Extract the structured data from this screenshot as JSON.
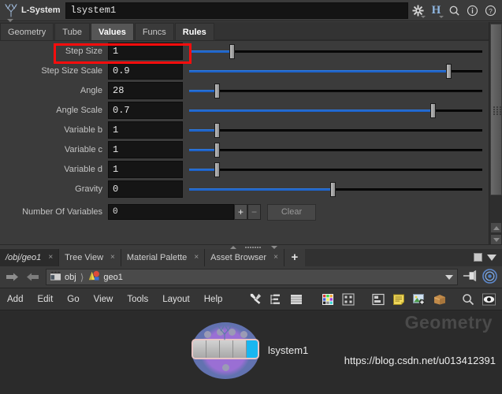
{
  "param_editor": {
    "op_type_icon": "lsystem-tree-icon",
    "op_type_label": "L-System",
    "op_name_value": "lsystem1",
    "header_icons": [
      {
        "name": "gear-icon",
        "glyph": "⚙"
      },
      {
        "name": "houdini-h-icon",
        "glyph": "H"
      },
      {
        "name": "search-icon",
        "glyph": "○"
      },
      {
        "name": "info-icon",
        "glyph": "i"
      },
      {
        "name": "help-icon",
        "glyph": "?"
      }
    ],
    "tabs": [
      {
        "label": "Geometry",
        "selected": false,
        "bold": false
      },
      {
        "label": "Tube",
        "selected": false,
        "bold": false
      },
      {
        "label": "Values",
        "selected": true,
        "bold": true
      },
      {
        "label": "Funcs",
        "selected": false,
        "bold": false
      },
      {
        "label": "Rules",
        "selected": false,
        "bold": true
      }
    ],
    "parameters": [
      {
        "label": "Step Size",
        "value": "1",
        "slider_pct": 14.5,
        "highlighted": true
      },
      {
        "label": "Step Size Scale",
        "value": "0.9",
        "slider_pct": 88.5,
        "highlighted": false
      },
      {
        "label": "Angle",
        "value": "28",
        "slider_pct": 9.5,
        "highlighted": false
      },
      {
        "label": "Angle Scale",
        "value": "0.7",
        "slider_pct": 83.0,
        "highlighted": false
      },
      {
        "label": "Variable b",
        "value": "1",
        "slider_pct": 9.5,
        "highlighted": false
      },
      {
        "label": "Variable c",
        "value": "1",
        "slider_pct": 9.5,
        "highlighted": false
      },
      {
        "label": "Variable d",
        "value": "1",
        "slider_pct": 9.5,
        "highlighted": false
      },
      {
        "label": "Gravity",
        "value": "0",
        "slider_pct": 49.0,
        "highlighted": false
      }
    ],
    "multiparm": {
      "label": "Number Of Variables",
      "value": "0",
      "add_label": "+",
      "remove_label": "−",
      "clear_label": "Clear"
    },
    "highlight_color": "#fb0d0d",
    "slider_fill_color": "#1e63c8"
  },
  "network_pane": {
    "tabs": [
      {
        "label": "/obj/geo1",
        "active": true,
        "closable": true
      },
      {
        "label": "Tree View",
        "active": false,
        "closable": true
      },
      {
        "label": "Material Palette",
        "active": false,
        "closable": true
      },
      {
        "label": "Asset Browser",
        "active": false,
        "closable": true
      }
    ],
    "new_tab_label": "+",
    "path": {
      "back_icon": "back-arrow-icon",
      "forward_icon": "forward-arrow-icon",
      "crumbs": [
        {
          "icon": "obj-network-icon",
          "label": "obj"
        },
        {
          "icon": "geometry-node-icon",
          "label": "geo1"
        }
      ],
      "dropdown_icon": "chevron-down-icon",
      "pin_icon": "pin-icon",
      "target-icon": "target-icon"
    },
    "menu_items": [
      "Add",
      "Edit",
      "Go",
      "View",
      "Tools",
      "Layout",
      "Help"
    ],
    "toolbar_icons": [
      {
        "name": "tools-icon"
      },
      {
        "name": "hierarchy-icon"
      },
      {
        "name": "list-icon"
      },
      {
        "name": "color-palette-icon"
      },
      {
        "name": "grid-select-icon"
      },
      {
        "name": "layout-boxes-icon"
      },
      {
        "name": "sticky-note-icon"
      },
      {
        "name": "add-image-icon"
      },
      {
        "name": "package-icon"
      },
      {
        "name": "search-icon"
      },
      {
        "name": "eye-icon"
      }
    ],
    "canvas": {
      "context_watermark": "Geometry",
      "url_watermark": "https://blog.csdn.net/u013412391",
      "node": {
        "name": "lsystem1",
        "icon": "lsystem-tree-icon",
        "selected": true,
        "display_flag_color": "#19b6f0",
        "halo_color": "#9a6fd4"
      }
    }
  }
}
